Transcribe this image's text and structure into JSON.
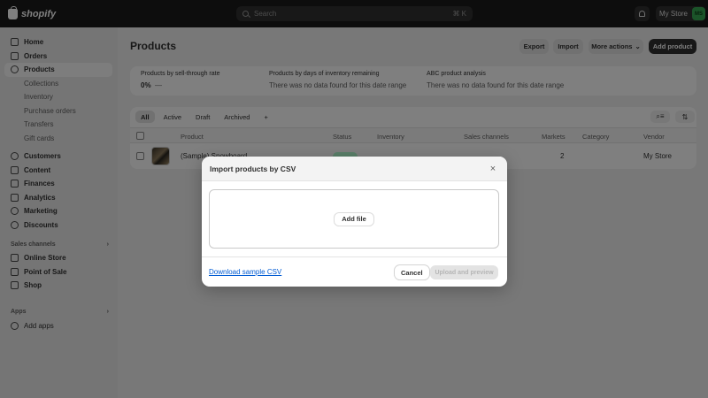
{
  "topbar": {
    "logo_text": "shopify",
    "search_placeholder": "Search",
    "search_shortcut": "⌘ K",
    "store_name": "My Store",
    "avatar_initials": "MS",
    "avatar_color": "#36a852"
  },
  "sidebar": {
    "items": [
      {
        "label": "Home",
        "icon": "home-icon"
      },
      {
        "label": "Orders",
        "icon": "orders-icon"
      },
      {
        "label": "Products",
        "icon": "tag-icon",
        "active": true
      },
      {
        "label": "Collections",
        "sub": true
      },
      {
        "label": "Inventory",
        "sub": true
      },
      {
        "label": "Purchase orders",
        "sub": true
      },
      {
        "label": "Transfers",
        "sub": true
      },
      {
        "label": "Gift cards",
        "sub": true
      },
      {
        "label": "Customers",
        "icon": "person-icon"
      },
      {
        "label": "Content",
        "icon": "content-icon"
      },
      {
        "label": "Finances",
        "icon": "bank-icon"
      },
      {
        "label": "Analytics",
        "icon": "chart-icon"
      },
      {
        "label": "Marketing",
        "icon": "target-icon"
      },
      {
        "label": "Discounts",
        "icon": "discount-icon"
      }
    ],
    "sales_channels_heading": "Sales channels",
    "sales_channels": [
      {
        "label": "Online Store",
        "icon": "store-icon"
      },
      {
        "label": "Point of Sale",
        "icon": "pos-icon"
      },
      {
        "label": "Shop",
        "icon": "shop-icon"
      }
    ],
    "apps_heading": "Apps",
    "add_apps": "Add apps"
  },
  "header": {
    "title": "Products",
    "export": "Export",
    "import": "Import",
    "more_actions": "More actions",
    "add_product": "Add product"
  },
  "analytics": [
    {
      "label": "Products by sell-through rate",
      "value_bold": "0%",
      "value": "—"
    },
    {
      "label": "Products by days of inventory remaining",
      "value": "There was no data found for this date range"
    },
    {
      "label": "ABC product analysis",
      "value": "There was no data found for this date range"
    }
  ],
  "tabs": [
    "All",
    "Active",
    "Draft",
    "Archived",
    "+"
  ],
  "table": {
    "columns": [
      "Product",
      "Status",
      "Inventory",
      "Sales channels",
      "Markets",
      "Category",
      "Vendor"
    ],
    "rows": [
      {
        "product": "(Sample) Snowboard",
        "markets": "2",
        "vendor": "My Store"
      }
    ]
  },
  "modal": {
    "title": "Import products by CSV",
    "add_file": "Add file",
    "download_link": "Download sample CSV",
    "cancel": "Cancel",
    "upload": "Upload and preview"
  }
}
